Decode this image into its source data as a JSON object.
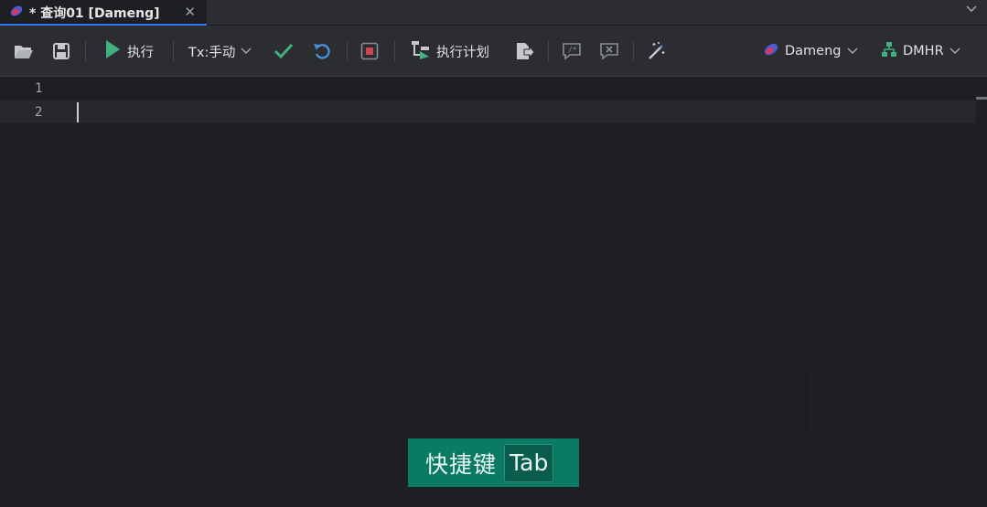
{
  "tab": {
    "title": "* 查询01 [Dameng]"
  },
  "toolbar": {
    "execute_label": "执行",
    "tx_mode_label": "Tx:手动",
    "explain_plan_label": "执行计划",
    "datasource_label": "Dameng",
    "schema_label": "DMHR"
  },
  "editor": {
    "line_numbers": [
      "1",
      "2"
    ]
  },
  "overlay": {
    "shortcut_label": "快捷键",
    "shortcut_key": "Tab"
  },
  "colors": {
    "run_green": "#3fb27f",
    "accent_teal": "#0b7a65",
    "stop_red": "#c9494e",
    "rollback_blue": "#4a8fd8"
  }
}
